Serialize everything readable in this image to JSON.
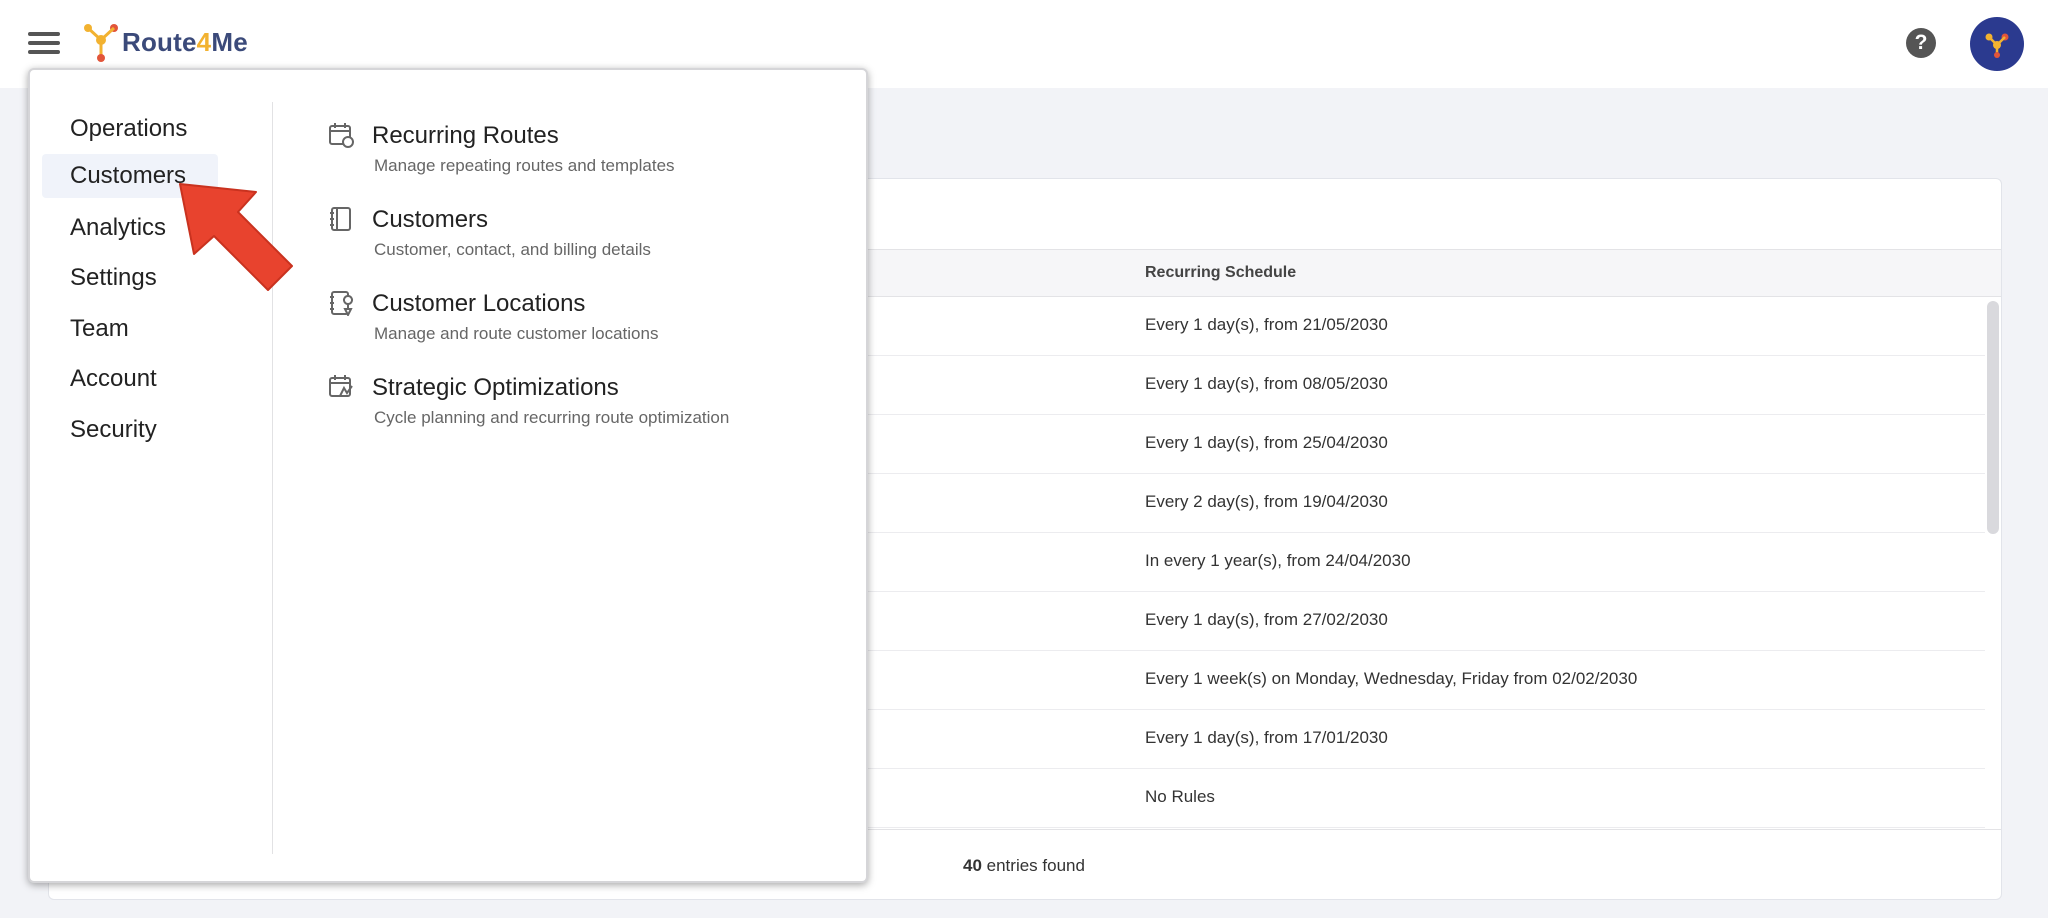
{
  "header": {
    "logo": {
      "text_route": "Route",
      "text_four": "4",
      "text_me": "Me"
    },
    "help_label": "?",
    "icons": {
      "menu": "hamburger-icon",
      "help": "help-icon",
      "avatar": "route4me-avatar-icon"
    },
    "colors": {
      "brand_navy": "#3b4a7a",
      "brand_yellow": "#f2b230",
      "avatar_bg": "#2b3a8f"
    }
  },
  "table": {
    "columns": {
      "schedule": "Recurring Schedule"
    },
    "rows": [
      "Every 1 day(s), from 21/05/2030",
      "Every 1 day(s), from 08/05/2030",
      "Every 1 day(s), from 25/04/2030",
      "Every 2 day(s), from 19/04/2030",
      "In every 1 year(s), from 24/04/2030",
      "Every 1 day(s), from 27/02/2030",
      "Every 1 week(s) on Monday, Wednesday, Friday from 02/02/2030",
      "Every 1 day(s), from 17/01/2030",
      "No Rules"
    ],
    "footer": {
      "count": "40",
      "suffix": " entries found"
    }
  },
  "menu": {
    "nav": [
      {
        "label": "Operations",
        "active": false
      },
      {
        "label": "Customers",
        "active": true
      },
      {
        "label": "Analytics",
        "active": false
      },
      {
        "label": "Settings",
        "active": false
      },
      {
        "label": "Team",
        "active": false
      },
      {
        "label": "Account",
        "active": false
      },
      {
        "label": "Security",
        "active": false
      }
    ],
    "sub": [
      {
        "title": "Recurring Routes",
        "desc": "Manage repeating routes and templates",
        "icon": "calendar-recurring-icon"
      },
      {
        "title": "Customers",
        "desc": "Customer, contact, and billing details",
        "icon": "address-book-icon"
      },
      {
        "title": "Customer Locations",
        "desc": "Manage and route customer locations",
        "icon": "address-book-location-icon"
      },
      {
        "title": "Strategic Optimizations",
        "desc": "Cycle planning and recurring route optimization",
        "icon": "calendar-optimization-icon"
      }
    ]
  },
  "annotation": {
    "icon": "red-pointer-arrow",
    "color": "#e8432e"
  }
}
